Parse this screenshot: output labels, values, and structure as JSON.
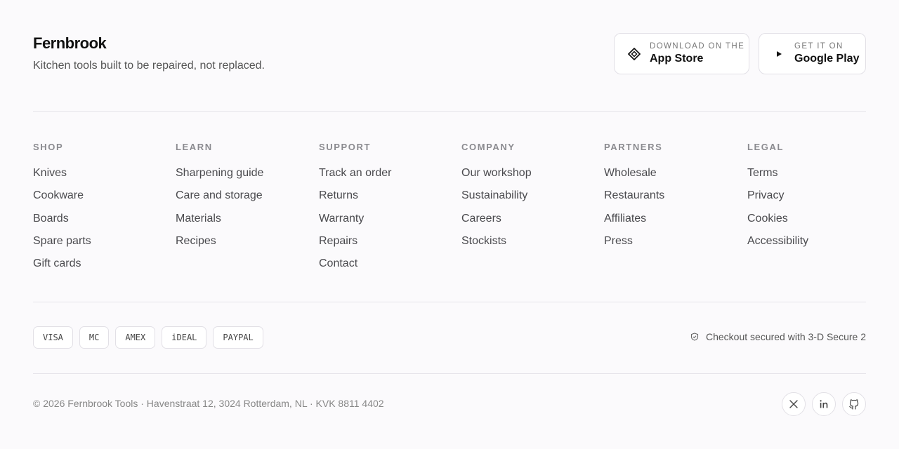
{
  "brand": {
    "name": "Fernbrook",
    "tagline": "Kitchen tools built to be repaired, not replaced."
  },
  "stores": {
    "app_store": {
      "small": "DOWNLOAD ON THE",
      "big": "App Store",
      "icon": "app-store-icon"
    },
    "google_play": {
      "small": "GET IT ON",
      "big": "Google Play",
      "icon": "play-icon"
    }
  },
  "columns": [
    {
      "heading": "SHOP",
      "links": [
        "Knives",
        "Cookware",
        "Boards",
        "Spare parts",
        "Gift cards"
      ]
    },
    {
      "heading": "LEARN",
      "links": [
        "Sharpening guide",
        "Care and storage",
        "Materials",
        "Recipes"
      ]
    },
    {
      "heading": "SUPPORT",
      "links": [
        "Track an order",
        "Returns",
        "Warranty",
        "Repairs",
        "Contact"
      ]
    },
    {
      "heading": "COMPANY",
      "links": [
        "Our workshop",
        "Sustainability",
        "Careers",
        "Stockists"
      ]
    },
    {
      "heading": "PARTNERS",
      "links": [
        "Wholesale",
        "Restaurants",
        "Affiliates",
        "Press"
      ]
    },
    {
      "heading": "LEGAL",
      "links": [
        "Terms",
        "Privacy",
        "Cookies",
        "Accessibility"
      ]
    }
  ],
  "payments": [
    "VISA",
    "MC",
    "AMEX",
    "iDEAL",
    "PAYPAL"
  ],
  "secure": {
    "text": "Checkout secured with 3-D Secure 2",
    "icon": "shield-check-icon"
  },
  "copyright": "© 2026 Fernbrook Tools · Havenstraat 12, 3024 Rotterdam, NL · KVK 8811 4402",
  "socials": [
    {
      "name": "x-icon"
    },
    {
      "name": "linkedin-icon"
    },
    {
      "name": "github-icon"
    }
  ],
  "colors": {
    "background": "#fbfafc",
    "border": "#e2e0e6",
    "text": "#1a1a1a"
  }
}
